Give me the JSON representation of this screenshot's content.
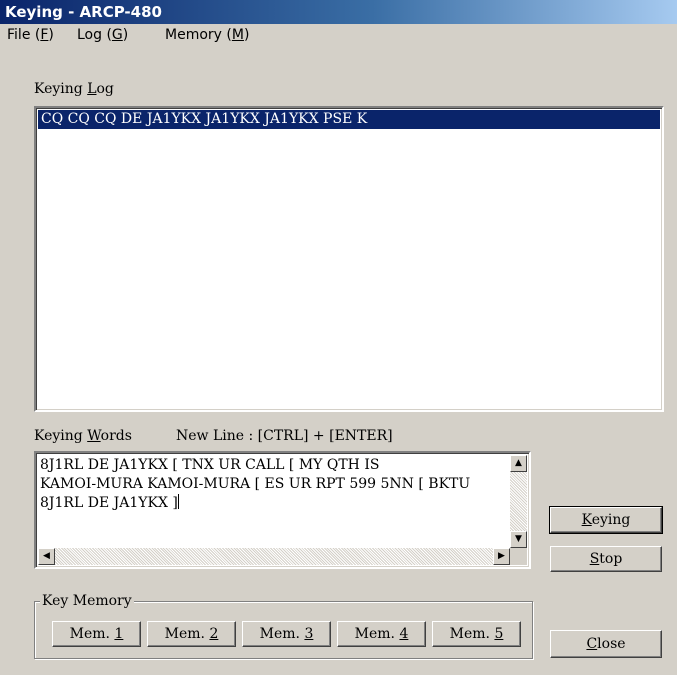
{
  "window": {
    "title": "Keying - ARCP-480"
  },
  "menu": [
    {
      "label": "File (",
      "key": "F",
      "tail": ")"
    },
    {
      "label": "Log (",
      "key": "G",
      "tail": ")"
    },
    {
      "label": "Memory (",
      "key": "M",
      "tail": ")"
    }
  ],
  "keying_log": {
    "label_pre": "Keying ",
    "label_key": "L",
    "label_post": "og",
    "selected_line": "CQ CQ CQ DE JA1YKX JA1YKX JA1YKX PSE K"
  },
  "keying_words": {
    "label_pre": "Keying ",
    "label_key": "W",
    "label_post": "ords",
    "hint": "New Line  :  [CTRL] + [ENTER]",
    "text": "8J1RL DE JA1YKX [ TNX UR CALL [ MY QTH IS\nKAMOI-MURA KAMOI-MURA [ ES UR RPT 599 5NN [ BKTU\n8J1RL DE JA1YKX ]"
  },
  "buttons": {
    "keying": {
      "pre": "",
      "key": "K",
      "post": "eying"
    },
    "stop": {
      "pre": "",
      "key": "S",
      "post": "top"
    },
    "close": {
      "pre": "",
      "key": "C",
      "post": "lose"
    }
  },
  "key_memory": {
    "title": "Key Memory",
    "buttons": [
      {
        "pre": "Mem. ",
        "key": "1"
      },
      {
        "pre": "Mem. ",
        "key": "2"
      },
      {
        "pre": "Mem. ",
        "key": "3"
      },
      {
        "pre": "Mem. ",
        "key": "4"
      },
      {
        "pre": "Mem. ",
        "key": "5"
      }
    ]
  }
}
